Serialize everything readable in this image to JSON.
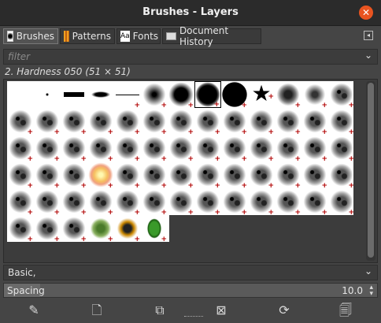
{
  "window": {
    "title": "Brushes - Layers"
  },
  "tabs": [
    {
      "label": "Brushes",
      "icon": "brush-icon"
    },
    {
      "label": "Patterns",
      "icon": "pattern-icon"
    },
    {
      "label": "Fonts",
      "icon": "font-icon"
    },
    {
      "label": "Document History",
      "icon": "history-icon"
    }
  ],
  "filter": {
    "placeholder": "filter"
  },
  "selected_brush": "2. Hardness 050 (51 × 51)",
  "tag": {
    "value": "Basic,"
  },
  "spacing": {
    "label": "Spacing",
    "value": "10.0",
    "fraction": 0.1
  },
  "toolbar": [
    {
      "icon": "edit-brush-icon",
      "symbol": "✎"
    },
    {
      "icon": "new-brush-icon",
      "symbol": "🗋"
    },
    {
      "icon": "duplicate-brush-icon",
      "symbol": "⧉"
    },
    {
      "icon": "delete-brush-icon",
      "symbol": "⊠"
    },
    {
      "icon": "refresh-icon",
      "symbol": "⟳"
    },
    {
      "icon": "open-as-image-icon",
      "symbol": "🗐"
    }
  ]
}
